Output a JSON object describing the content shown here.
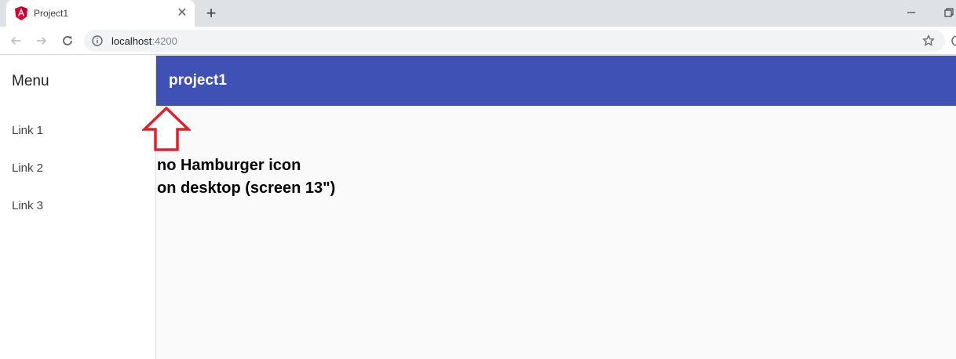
{
  "browser": {
    "tab_title": "Project1",
    "url_host": "localhost",
    "url_port": ":4200",
    "accent_color": "#dd0031"
  },
  "sidenav": {
    "title": "Menu",
    "links": [
      "Link 1",
      "Link 2",
      "Link 3"
    ]
  },
  "app": {
    "title": "project1",
    "toolbar_color": "#3f51b5"
  },
  "annotation": {
    "line1": "no Hamburger icon",
    "line2": "on desktop (screen 13\")",
    "arrow_color": "#e0202c"
  }
}
